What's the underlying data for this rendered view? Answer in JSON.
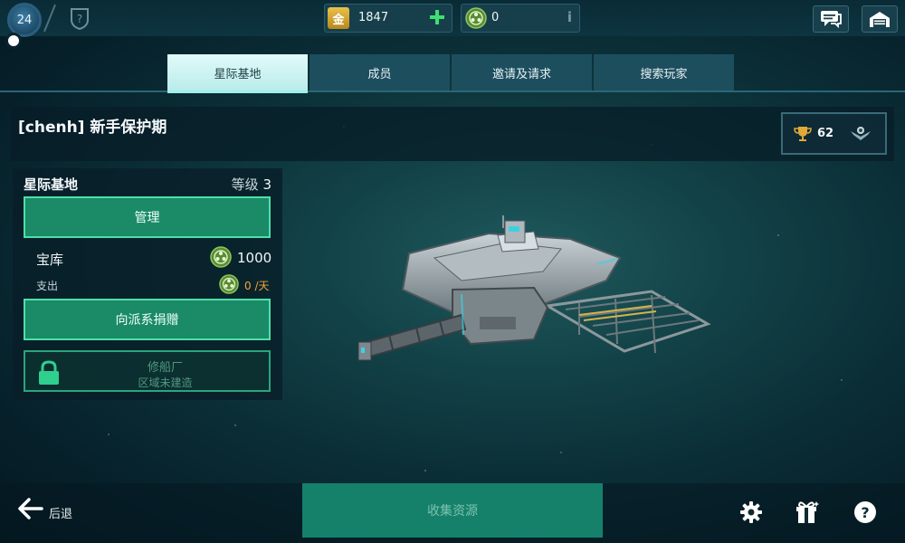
{
  "topbar": {
    "player_level": "24",
    "gold": {
      "glyph": "金",
      "value": "1847"
    },
    "tokens": {
      "value": "0"
    },
    "info_glyph": "i",
    "icons": [
      "shield-question-icon",
      "plus-icon",
      "token-icon",
      "chat-icon",
      "hangar-icon"
    ]
  },
  "tabs": [
    {
      "label": "星际基地",
      "active": true
    },
    {
      "label": "成员",
      "active": false
    },
    {
      "label": "邀请及请求",
      "active": false
    },
    {
      "label": "搜索玩家",
      "active": false
    }
  ],
  "header": {
    "title": "[chenh] 新手保护期",
    "trophies": "62"
  },
  "base_panel": {
    "title": "星际基地",
    "level_prefix": "等级",
    "level": "3",
    "manage_label": "管理",
    "vault_label": "宝库",
    "vault_value": "1000",
    "spend_label": "支出",
    "spend_value": "0 /天",
    "donate_label": "向派系捐赠",
    "shipyard_title": "修船厂",
    "shipyard_sub": "区域未建造"
  },
  "bottom": {
    "back_label": "后退",
    "collect_label": "收集资源",
    "icons": [
      "gear-icon",
      "gift-icon",
      "help-icon"
    ]
  },
  "colors": {
    "accent_green": "#1a8a67",
    "accent_border": "#4ee0a7",
    "active_tab": "#c8f3f1",
    "orange": "#f2a43a"
  }
}
